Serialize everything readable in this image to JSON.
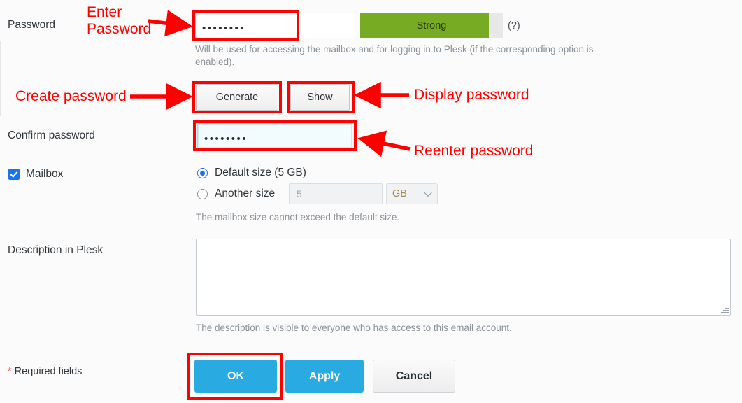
{
  "form": {
    "password": {
      "label": "Password",
      "value": "••••••••",
      "strength_text": "Strong",
      "strength_level": 100,
      "strength_color": "#76ab23",
      "help_icon": "(?)",
      "hint": "Will be used for accessing the mailbox and for logging in to Plesk (if the corresponding option is enabled)."
    },
    "buttons": {
      "generate": "Generate",
      "show": "Show"
    },
    "confirm": {
      "label": "Confirm password",
      "value": "••••••••"
    },
    "mailbox": {
      "label": "Mailbox",
      "checked": true,
      "option_default": "Default size (5 GB)",
      "option_another": "Another size",
      "another_value": "5",
      "unit": "GB",
      "hint": "The mailbox size cannot exceed the default size."
    },
    "description": {
      "label": "Description in Plesk",
      "value": "",
      "hint": "The description is visible to everyone who has access to this email account."
    },
    "footer": {
      "required_star": "*",
      "required_text": " Required fields",
      "ok": "OK",
      "apply": "Apply",
      "cancel": "Cancel",
      "primary_color": "#29abe2"
    }
  },
  "annotations": {
    "color": "#ff0000",
    "enter_password": "Enter\nPassword",
    "create_password": "Create password",
    "display_password": "Display password",
    "reenter_password": "Reenter password"
  }
}
